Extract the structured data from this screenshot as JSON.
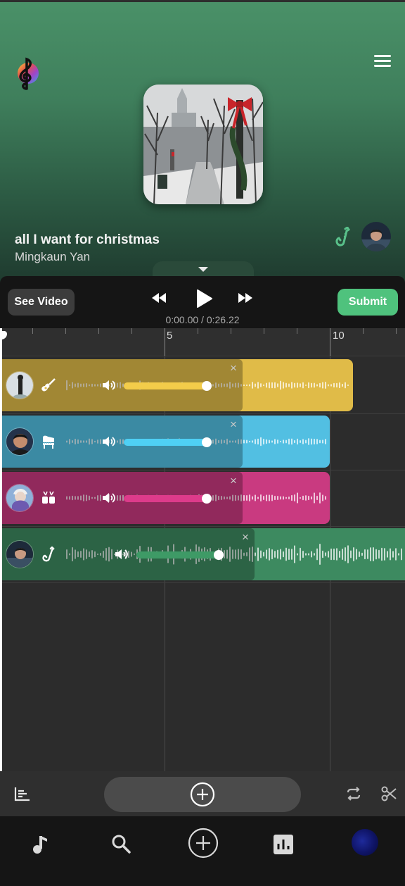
{
  "header": {
    "song_title": "all I want for christmas",
    "artist": "Mingkaun Yan",
    "logo_icon": "treble-clef-logo-icon",
    "menu_icon": "hamburger-menu-icon",
    "instrument_icon": "saxophone-icon",
    "collapse_icon": "chevron-down-icon"
  },
  "transport": {
    "see_video_label": "See Video",
    "rewind_icon": "rewind-icon",
    "play_icon": "play-icon",
    "fast_forward_icon": "fast-forward-icon",
    "time_readout": "0:00.00 / 0:26.22",
    "submit_label": "Submit"
  },
  "timeline": {
    "ruler_labels": [
      "5",
      "10"
    ],
    "close_label": "×",
    "tracks": [
      {
        "color": "#e3bd45",
        "instrument": "guitar-icon",
        "volume": 0.55
      },
      {
        "color": "#55c4e6",
        "instrument": "piano-icon",
        "volume": 0.55
      },
      {
        "color": "#cf3a84",
        "instrument": "drums-icon",
        "volume": 0.55
      },
      {
        "color": "#3f8c63",
        "instrument": "saxophone-icon",
        "volume": 0.7
      }
    ]
  },
  "toolbar": {
    "mixer_icon": "mixer-bars-icon",
    "add_track_icon": "plus-circle-icon",
    "loop_icon": "loop-icon",
    "scissors_icon": "scissors-icon"
  },
  "nav": {
    "items": [
      "music-note-icon",
      "search-icon",
      "plus-circle-icon",
      "chart-icon",
      "profile-avatar"
    ]
  },
  "colors": {
    "accent_green": "#4fc27d",
    "header_green": "#4a9168",
    "background": "#2c2c2c"
  }
}
